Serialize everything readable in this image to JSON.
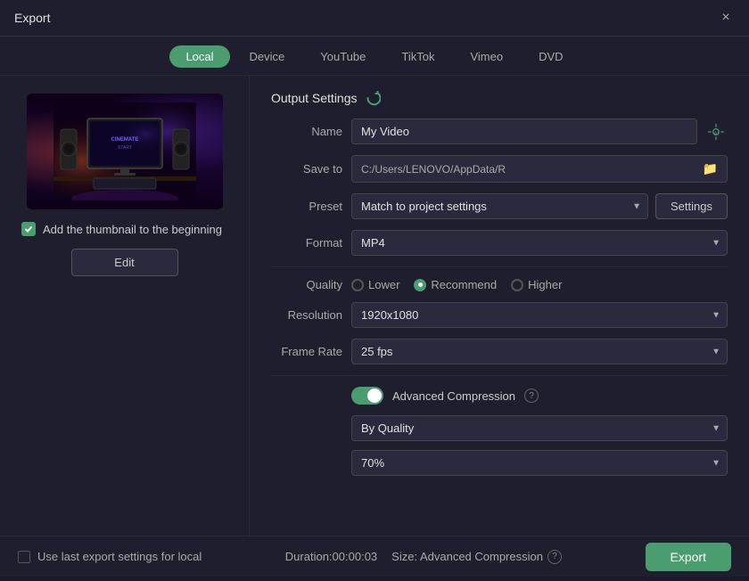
{
  "dialog": {
    "title": "Export",
    "close_label": "×"
  },
  "tabs": [
    {
      "id": "local",
      "label": "Local",
      "active": true
    },
    {
      "id": "device",
      "label": "Device",
      "active": false
    },
    {
      "id": "youtube",
      "label": "YouTube",
      "active": false
    },
    {
      "id": "tiktok",
      "label": "TikTok",
      "active": false
    },
    {
      "id": "vimeo",
      "label": "Vimeo",
      "active": false
    },
    {
      "id": "dvd",
      "label": "DVD",
      "active": false
    }
  ],
  "thumbnail": {
    "add_label": "Add the thumbnail to the beginning",
    "edit_label": "Edit",
    "monitor_text": "CINEMATE START"
  },
  "output_settings": {
    "header": "Output Settings",
    "name_label": "Name",
    "name_value": "My Video",
    "save_to_label": "Save to",
    "save_to_path": "C:/Users/LENOVO/AppData/R",
    "preset_label": "Preset",
    "preset_value": "Match to project settings",
    "settings_btn": "Settings",
    "format_label": "Format",
    "format_value": "MP4",
    "quality_label": "Quality",
    "quality_options": [
      {
        "id": "lower",
        "label": "Lower",
        "selected": false
      },
      {
        "id": "recommend",
        "label": "Recommend",
        "selected": true
      },
      {
        "id": "higher",
        "label": "Higher",
        "selected": false
      }
    ],
    "resolution_label": "Resolution",
    "resolution_value": "1920x1080",
    "frame_rate_label": "Frame Rate",
    "frame_rate_value": "25 fps",
    "advanced_compression_label": "Advanced Compression",
    "advanced_compression_enabled": true,
    "by_quality_value": "By Quality",
    "quality_percent_value": "70%"
  },
  "bottom": {
    "use_last_label": "Use last export settings for local",
    "duration_label": "Duration:00:00:03",
    "size_label": "Size: Advanced Compression",
    "export_label": "Export"
  },
  "colors": {
    "accent": "#4a9d6f",
    "bg_dark": "#1e1e2e",
    "bg_input": "#2a2a3e",
    "border": "#444",
    "text_muted": "#aaa"
  }
}
